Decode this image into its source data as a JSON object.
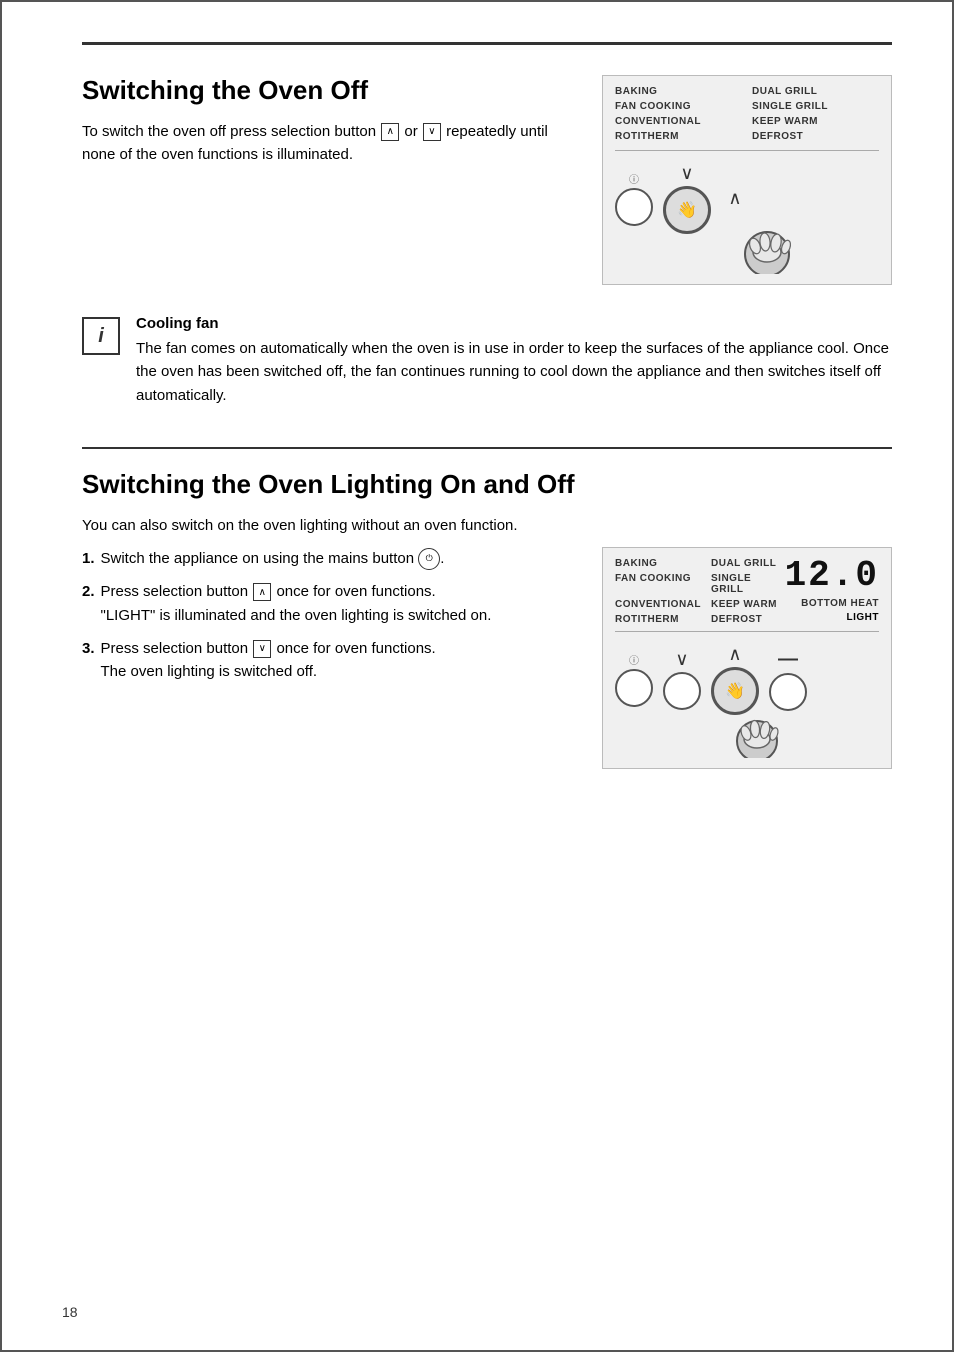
{
  "page": {
    "number": "18",
    "border_color": "#555"
  },
  "section1": {
    "title": "Switching the Oven Off",
    "paragraph": "To switch the oven off press selection button",
    "paragraph2": "or",
    "paragraph3": "repeatedly until none of the oven functions is illuminated.",
    "panel1": {
      "labels": [
        {
          "text": "BAKING",
          "col": 1
        },
        {
          "text": "DUAL GRILL",
          "col": 2
        },
        {
          "text": "FAN COOKING",
          "col": 1
        },
        {
          "text": "SINGLE GRILL",
          "col": 2
        },
        {
          "text": "CONVENTIONAL",
          "col": 1
        },
        {
          "text": "KEEP WARM",
          "col": 2
        },
        {
          "text": "ROTITHERM",
          "col": 1
        },
        {
          "text": "DEFROST",
          "col": 2
        }
      ]
    }
  },
  "info_box": {
    "icon": "i",
    "title": "Cooling fan",
    "text": "The fan comes on automatically when the oven is in use in order to keep the surfaces of the appliance cool. Once the oven has been switched off, the fan continues running to cool down the appliance and then switches itself off automatically."
  },
  "section2": {
    "title": "Switching the Oven Lighting On and Off",
    "intro": "You can also switch on the oven lighting without an oven function.",
    "steps": [
      {
        "num": "1.",
        "text": "Switch the appliance on using the mains button"
      },
      {
        "num": "2.",
        "text": "Press selection button",
        "text2": "once for oven functions.",
        "note": "\"LIGHT\" is illuminated and the oven lighting is switched on."
      },
      {
        "num": "3.",
        "text": "Press selection button",
        "text2": "once for oven functions.",
        "note": "The oven lighting is switched off."
      }
    ],
    "panel2": {
      "labels_left": [
        {
          "text": "BAKING"
        },
        {
          "text": "FAN COOKING"
        },
        {
          "text": "CONVENTIONAL"
        },
        {
          "text": "ROTITHERM"
        }
      ],
      "labels_right": [
        {
          "text": "DUAL GRILL"
        },
        {
          "text": "SINGLE GRILL"
        },
        {
          "text": "KEEP WARM"
        },
        {
          "text": "DEFROST"
        }
      ],
      "extra_right": [
        {
          "text": "BOTTOM HEAT"
        },
        {
          "text": "LIGHT",
          "highlighted": true
        }
      ],
      "digital": "12.0"
    }
  }
}
